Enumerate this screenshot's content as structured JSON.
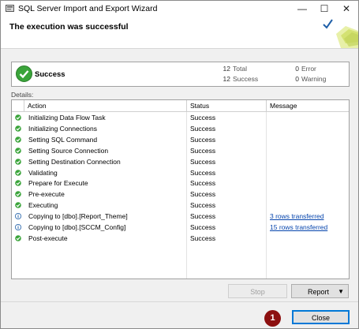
{
  "window": {
    "title": "SQL Server Import and Export Wizard",
    "minimize_glyph": "—",
    "maximize_glyph": "☐",
    "close_glyph": "✕"
  },
  "header": {
    "title": "The execution was successful",
    "art_icon": "wizard-check-icon"
  },
  "summary": {
    "status_label": "Success",
    "total_count": "12",
    "total_label": "Total",
    "success_count": "12",
    "success_label": "Success",
    "error_count": "0",
    "error_label": "Error",
    "warning_count": "0",
    "warning_label": "Warning"
  },
  "details": {
    "label": "Details:",
    "columns": [
      "Action",
      "Status",
      "Message"
    ],
    "rows": [
      {
        "icon": "success-icon",
        "action": "Initializing Data Flow Task",
        "status": "Success",
        "message": ""
      },
      {
        "icon": "success-icon",
        "action": "Initializing Connections",
        "status": "Success",
        "message": ""
      },
      {
        "icon": "success-icon",
        "action": "Setting SQL Command",
        "status": "Success",
        "message": ""
      },
      {
        "icon": "success-icon",
        "action": "Setting Source Connection",
        "status": "Success",
        "message": ""
      },
      {
        "icon": "success-icon",
        "action": "Setting Destination Connection",
        "status": "Success",
        "message": ""
      },
      {
        "icon": "success-icon",
        "action": "Validating",
        "status": "Success",
        "message": ""
      },
      {
        "icon": "success-icon",
        "action": "Prepare for Execute",
        "status": "Success",
        "message": ""
      },
      {
        "icon": "success-icon",
        "action": "Pre-execute",
        "status": "Success",
        "message": ""
      },
      {
        "icon": "success-icon",
        "action": "Executing",
        "status": "Success",
        "message": ""
      },
      {
        "icon": "info-icon",
        "action": "Copying to [dbo].[Report_Theme]",
        "status": "Success",
        "message": "3 rows transferred"
      },
      {
        "icon": "info-icon",
        "action": "Copying to [dbo].[SCCM_Config]",
        "status": "Success",
        "message": "15 rows transferred"
      },
      {
        "icon": "success-icon",
        "action": "Post-execute",
        "status": "Success",
        "message": ""
      }
    ]
  },
  "buttons": {
    "stop": "Stop",
    "report": "Report",
    "report_arrow": "▼",
    "close": "Close"
  },
  "annotation": {
    "badge_number": "1"
  },
  "colors": {
    "success_green": "#3aa43a",
    "info_blue": "#1f5fa8",
    "link": "#0645ad",
    "badge": "#8c1010"
  }
}
